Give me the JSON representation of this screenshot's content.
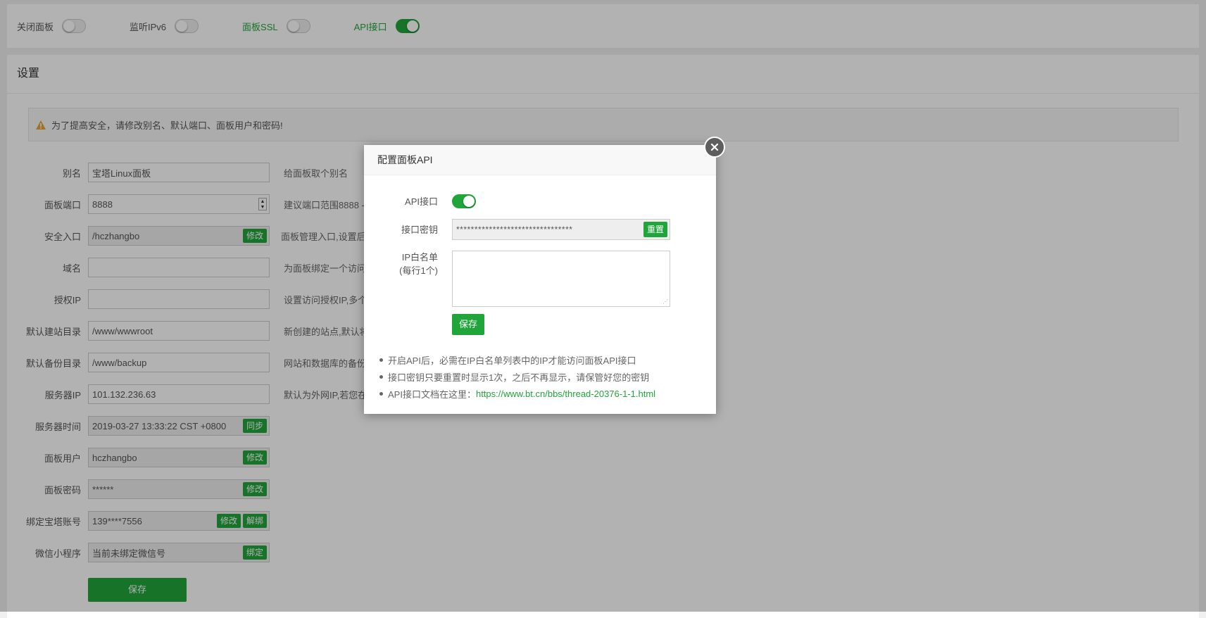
{
  "topbar": {
    "toggles": [
      {
        "label": "关闭面板",
        "on": false
      },
      {
        "label": "监听IPv6",
        "on": false
      },
      {
        "label": "面板SSL",
        "on": false
      },
      {
        "label": "API接口",
        "on": true
      }
    ]
  },
  "settings": {
    "title": "设置",
    "warning": "为了提高安全，请修改别名、默认端口、面板用户和密码!",
    "rows": [
      {
        "label": "别名",
        "value": "宝塔Linux面板",
        "desc": "给面板取个别名"
      },
      {
        "label": "面板端口",
        "value": "8888",
        "desc": "建议端口范围8888 -"
      },
      {
        "label": "安全入口",
        "value": "/hczhangbo",
        "btn": "修改",
        "desc": "面板管理入口,设置后只"
      },
      {
        "label": "域名",
        "value": "",
        "desc": "为面板绑定一个访问域"
      },
      {
        "label": "授权IP",
        "value": "",
        "desc": "设置访问授权IP,多个"
      },
      {
        "label": "默认建站目录",
        "value": "/www/wwwroot",
        "desc": "新创建的站点,默认将"
      },
      {
        "label": "默认备份目录",
        "value": "/www/backup",
        "desc": "网站和数据库的备份目"
      },
      {
        "label": "服务器IP",
        "value": "101.132.236.63",
        "desc": "默认为外网IP,若您在"
      },
      {
        "label": "服务器时间",
        "value": "2019-03-27 13:33:22 CST +0800",
        "btn": "同步"
      },
      {
        "label": "面板用户",
        "value": "hczhangbo",
        "btn": "修改"
      },
      {
        "label": "面板密码",
        "value": "******",
        "btn": "修改"
      },
      {
        "label": "绑定宝塔账号",
        "value": "139****7556",
        "btn": "修改",
        "btn2": "解绑"
      },
      {
        "label": "微信小程序",
        "value": "当前未绑定微信号",
        "btn": "绑定"
      }
    ],
    "save_label": "保存"
  },
  "modal": {
    "title": "配置面板API",
    "api_label": "API接口",
    "api_on": true,
    "key_label": "接口密钥",
    "key_value": "********************************",
    "reset_label": "重置",
    "whitelist_label_1": "IP白名单",
    "whitelist_label_2": "(每行1个)",
    "whitelist_value": "",
    "save_label": "保存",
    "tips": [
      "开启API后，必需在IP白名单列表中的IP才能访问面板API接口",
      "接口密钥只要重置时显示1次，之后不再显示，请保管好您的密钥"
    ],
    "doc_prefix": "API接口文档在这里：",
    "doc_link": "https://www.bt.cn/bbs/thread-20376-1-1.html"
  }
}
